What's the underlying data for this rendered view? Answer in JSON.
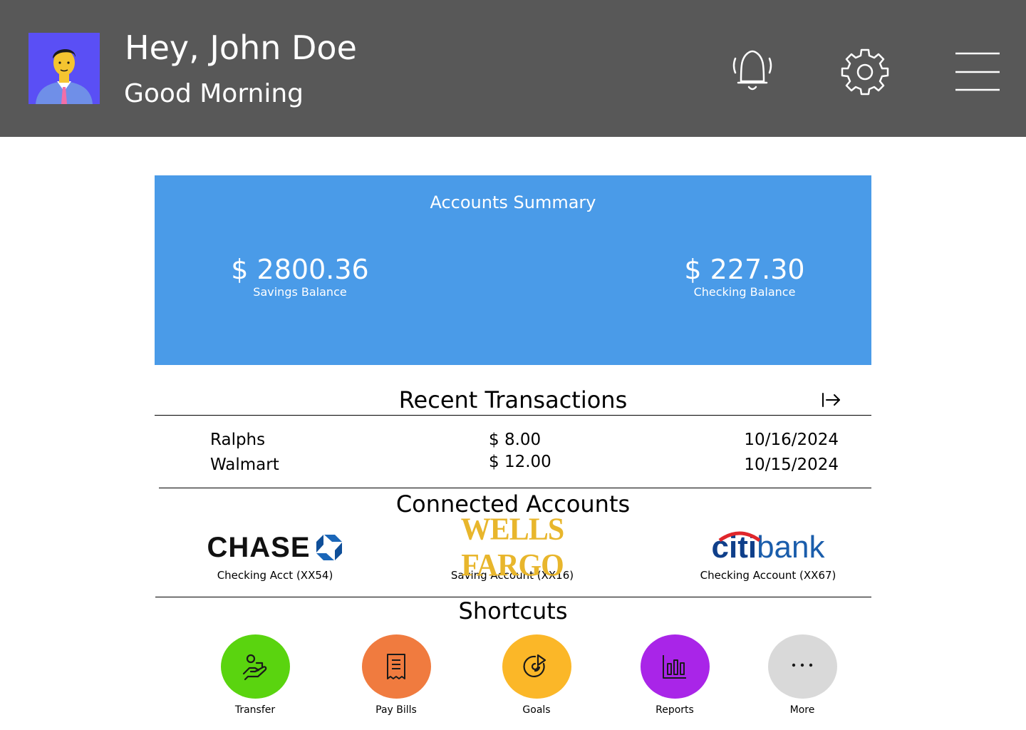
{
  "header": {
    "greeting": "Hey, John Doe",
    "subtitle": "Good Morning",
    "icons": [
      "avatar",
      "bell-icon",
      "gear-icon",
      "hamburger-menu-icon"
    ]
  },
  "summary": {
    "title": "Accounts Summary",
    "savings": {
      "amount": "$ 2800.36",
      "label": "Savings Balance"
    },
    "checking": {
      "amount": "$ 227.30",
      "label": "Checking Balance"
    },
    "color": "#4a9be8"
  },
  "transactions": {
    "title": "Recent Transactions",
    "rows": [
      {
        "merchant": "Ralphs",
        "amount": "$ 8.00",
        "date": "10/16/2024"
      },
      {
        "merchant": "Walmart",
        "amount": "$ 12.00",
        "date": "10/15/2024"
      }
    ]
  },
  "connected": {
    "title": "Connected Accounts",
    "accounts": [
      {
        "bank": "CHASE",
        "label": "Checking Acct (XX54)"
      },
      {
        "bank": "WELLS FARGO",
        "label": "Saving Account (XX16)"
      },
      {
        "bank": "citibank",
        "label": "Checking Account (XX67)"
      }
    ]
  },
  "shortcuts": {
    "title": "Shortcuts",
    "items": [
      {
        "label": "Transfer",
        "color": "#5ad40f",
        "icon": "hand-coin-icon"
      },
      {
        "label": "Pay Bills",
        "color": "#f07b3f",
        "icon": "receipt-icon"
      },
      {
        "label": "Goals",
        "color": "#fbb728",
        "icon": "target-icon"
      },
      {
        "label": "Reports",
        "color": "#a925e8",
        "icon": "bar-chart-icon"
      },
      {
        "label": "More",
        "color": "#d9d9d9",
        "icon": "more-dots-icon"
      }
    ]
  }
}
